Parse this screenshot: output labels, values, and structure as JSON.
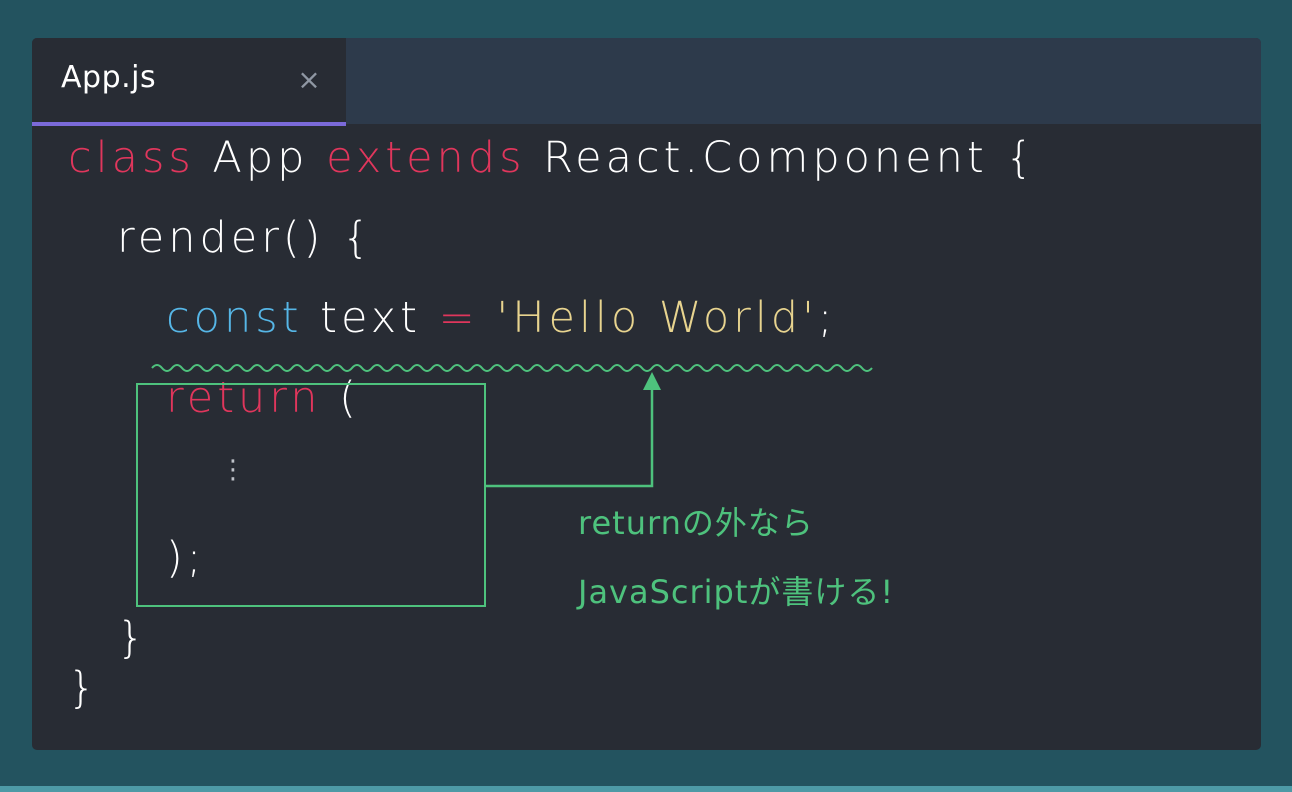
{
  "tab": {
    "title": "App.js",
    "close_icon": "×"
  },
  "code": {
    "line1": {
      "kw1": "class",
      "name": " App ",
      "kw2": "extends",
      "rest": " React.Component {"
    },
    "line2": "render() {",
    "line3": {
      "kw": "const",
      "name": " text ",
      "op": "=",
      "str": " 'Hello World'",
      "semi": ";"
    },
    "line4": {
      "kw": "return",
      "rest": " ("
    },
    "line5": "⋮",
    "line6": ");",
    "line7": "}",
    "line8": "}"
  },
  "annotation": {
    "line1": "returnの外なら",
    "line2": "JavaScriptが書ける!"
  },
  "colors": {
    "background": "#23535f",
    "editor": "#282c34",
    "tabbar": "#2d3a4b",
    "tab_underline": "#7b6ad9",
    "keyword_pink": "#e0365c",
    "keyword_blue": "#56b6e6",
    "string": "#e8d48f",
    "annotation_green": "#4ec27d"
  }
}
